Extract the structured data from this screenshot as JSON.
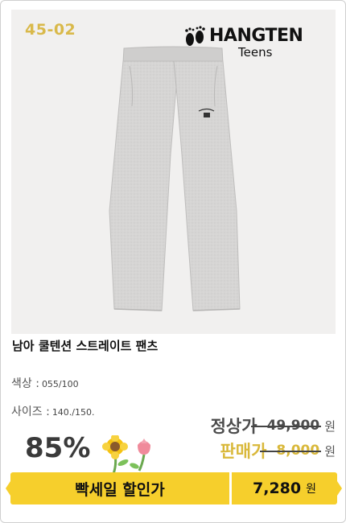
{
  "product": {
    "code": "45-02",
    "brand": {
      "name": "HANGTEN",
      "sub": "Teens"
    },
    "image": {
      "subject": "gray cotton straight pants",
      "color": "#d6d5d4"
    },
    "title": "남아 쿨텐션 스트레이트 팬츠"
  },
  "specs": {
    "color_label": "색상 :",
    "color_value": "055/100",
    "size_label": "사이즈 :",
    "size_value": "140./150."
  },
  "discount": {
    "percent": "85%",
    "icon": "flowers-icon"
  },
  "prices": {
    "regular_label": "정상가",
    "regular_amount": "49,900",
    "sale_label": "판매가",
    "sale_amount": "8,000",
    "won": "원"
  },
  "banner": {
    "text": "빡세일 할인가",
    "final_amount": "7,280",
    "won": "원"
  },
  "colors": {
    "accent_yellow": "#f6cf2c",
    "code_gold": "#d9b94a",
    "sale_gold": "#d9b83a",
    "dark_text": "#4c4c4c"
  }
}
